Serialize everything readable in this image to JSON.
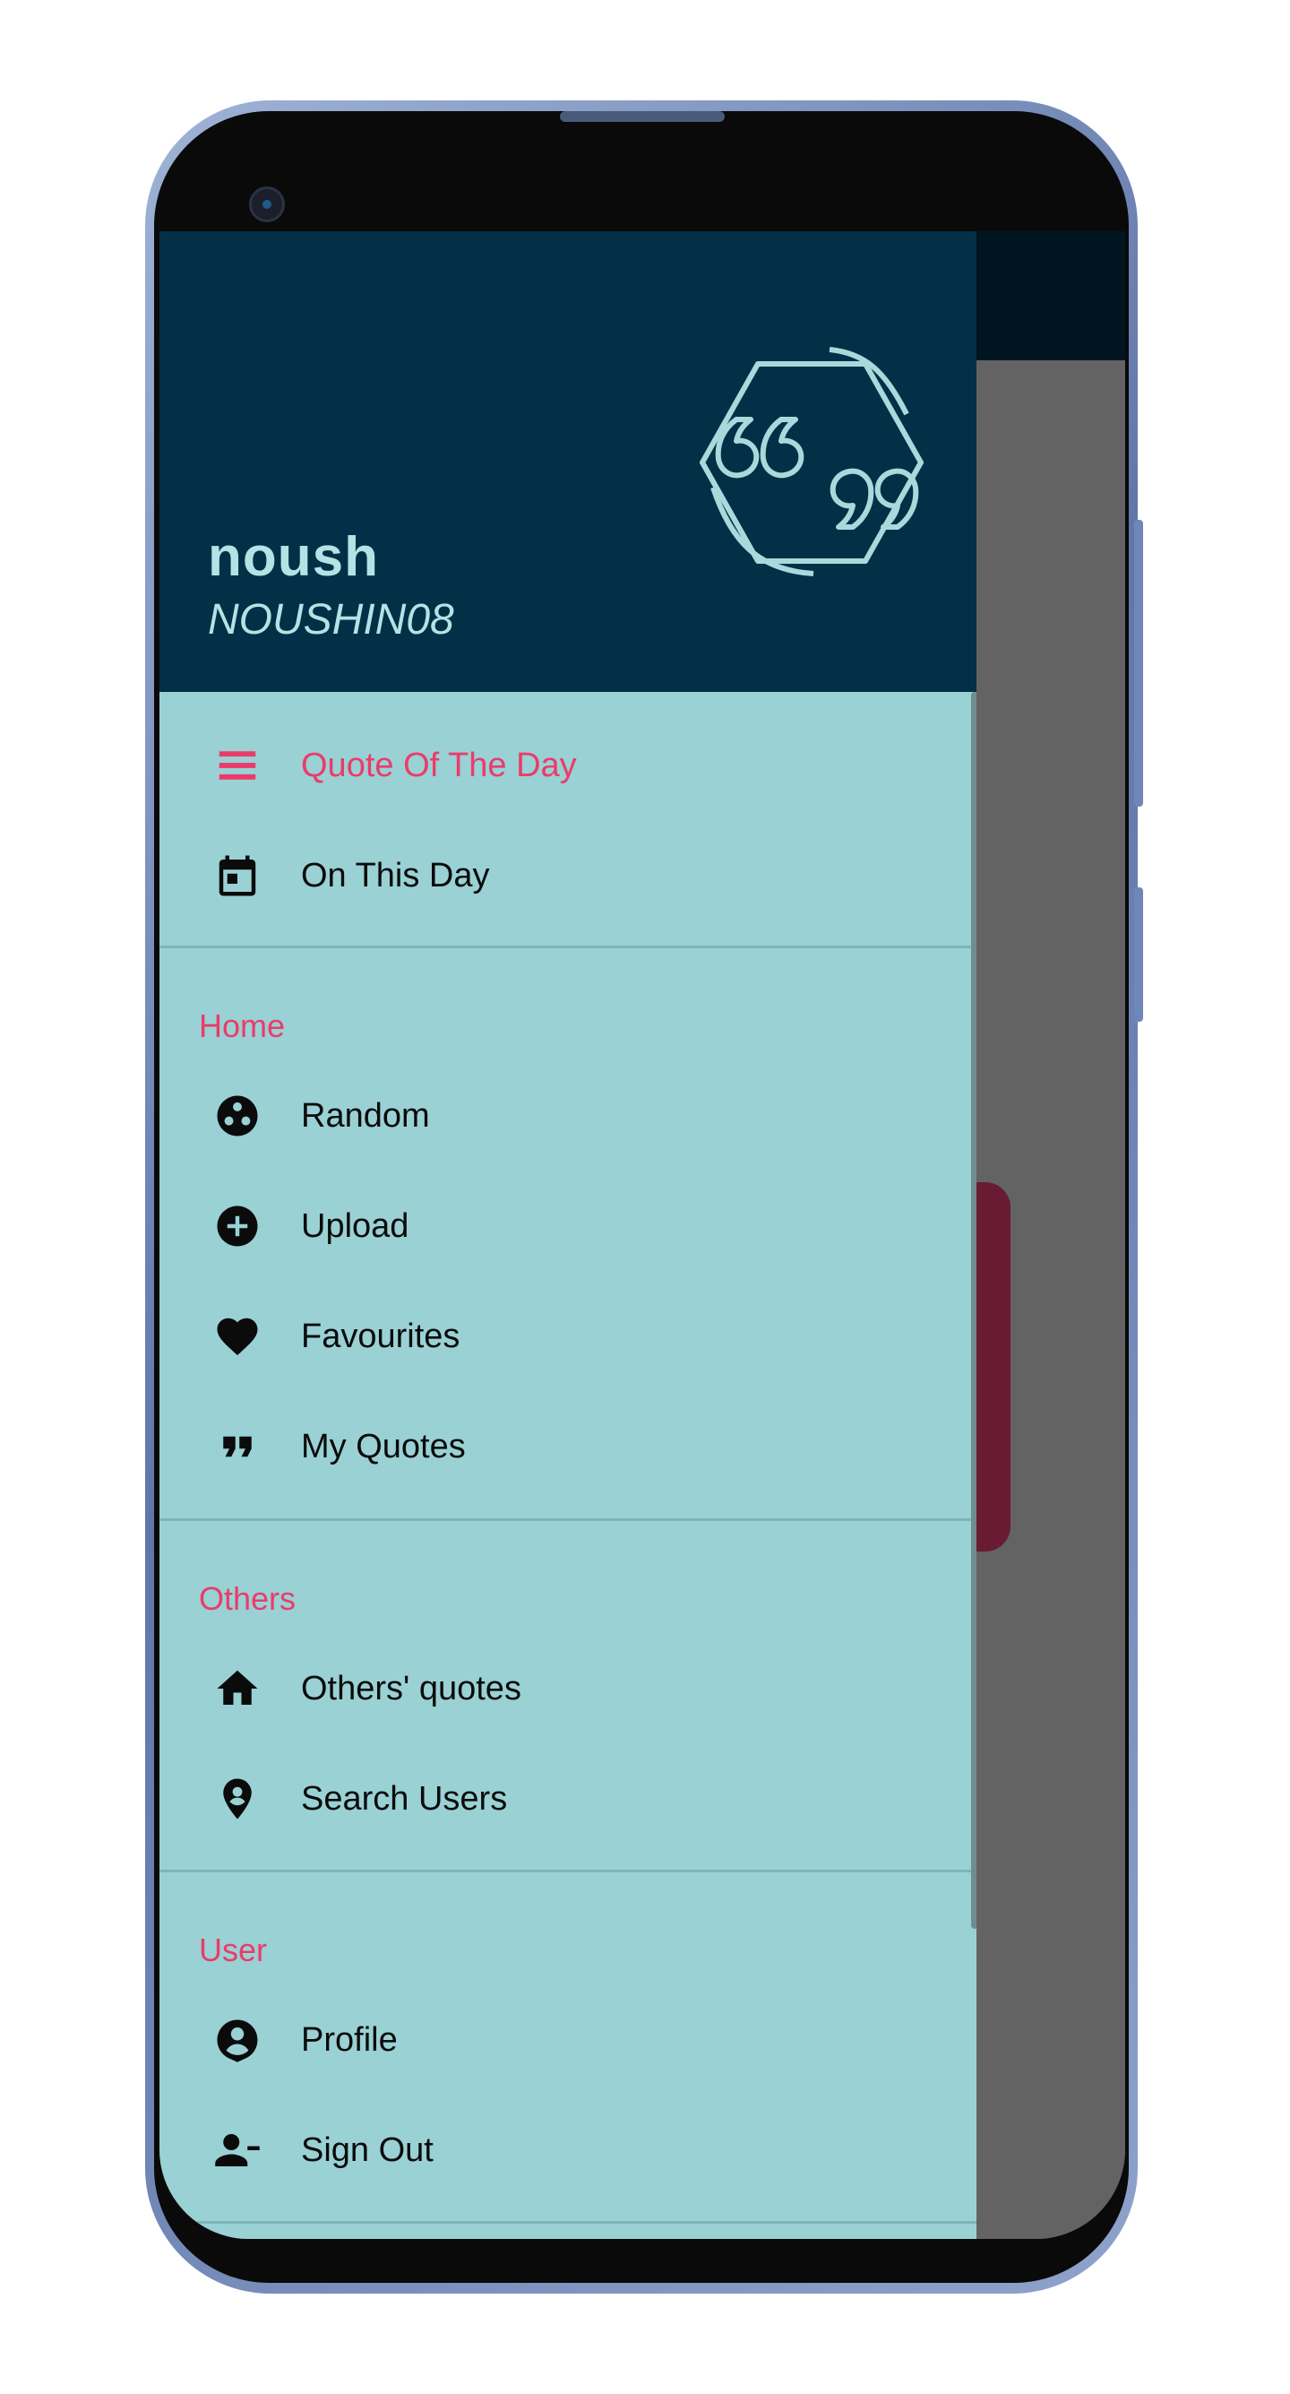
{
  "colors": {
    "header_bg": "#023047",
    "drawer_bg": "#9ad1d4",
    "accent": "#ea3c6b",
    "header_text": "#b5e2e4"
  },
  "user": {
    "name": "noush",
    "handle": "NOUSHIN08"
  },
  "menu": {
    "primary": [
      {
        "label": "Quote Of The Day",
        "icon": "list-icon",
        "selected": true
      },
      {
        "label": "On This Day",
        "icon": "calendar-icon",
        "selected": false
      }
    ],
    "sections": [
      {
        "title": "Home",
        "items": [
          {
            "label": "Random",
            "icon": "random-icon"
          },
          {
            "label": "Upload",
            "icon": "add-circle-icon"
          },
          {
            "label": "Favourites",
            "icon": "heart-icon"
          },
          {
            "label": "My Quotes",
            "icon": "quote-icon"
          }
        ]
      },
      {
        "title": "Others",
        "items": [
          {
            "label": "Others' quotes",
            "icon": "home-icon"
          },
          {
            "label": "Search Users",
            "icon": "location-pin-icon"
          }
        ]
      },
      {
        "title": "User",
        "items": [
          {
            "label": "Profile",
            "icon": "account-circle-icon"
          },
          {
            "label": "Sign Out",
            "icon": "person-remove-icon"
          }
        ]
      }
    ]
  }
}
